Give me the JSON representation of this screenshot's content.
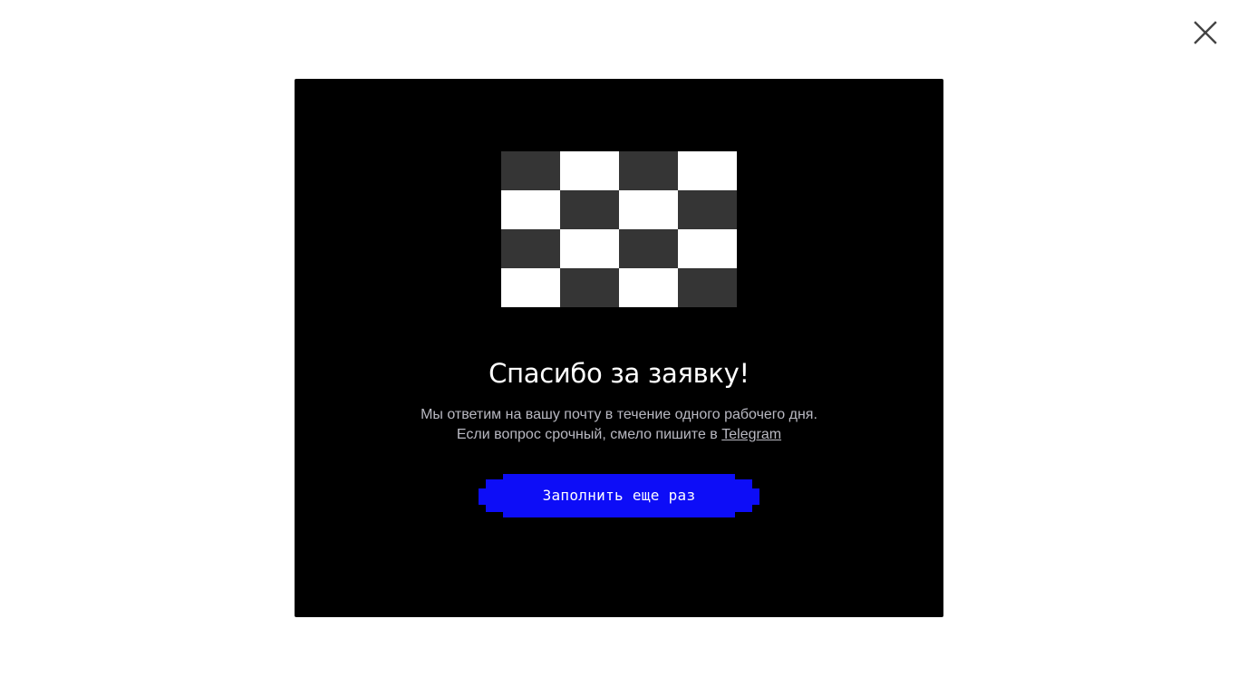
{
  "close_icon": "close-icon",
  "modal": {
    "title": "Спасибо за заявку!",
    "text_before_link": "Мы ответим на вашу почту в течение одного рабочего дня. Если вопрос срочный, смело пишите в ",
    "telegram_link": "Telegram",
    "button_label": "Заполнить еще раз",
    "button_color": "#0d0df7",
    "checker_colors": [
      "#353535",
      "#ffffff"
    ],
    "background": "#000000"
  }
}
